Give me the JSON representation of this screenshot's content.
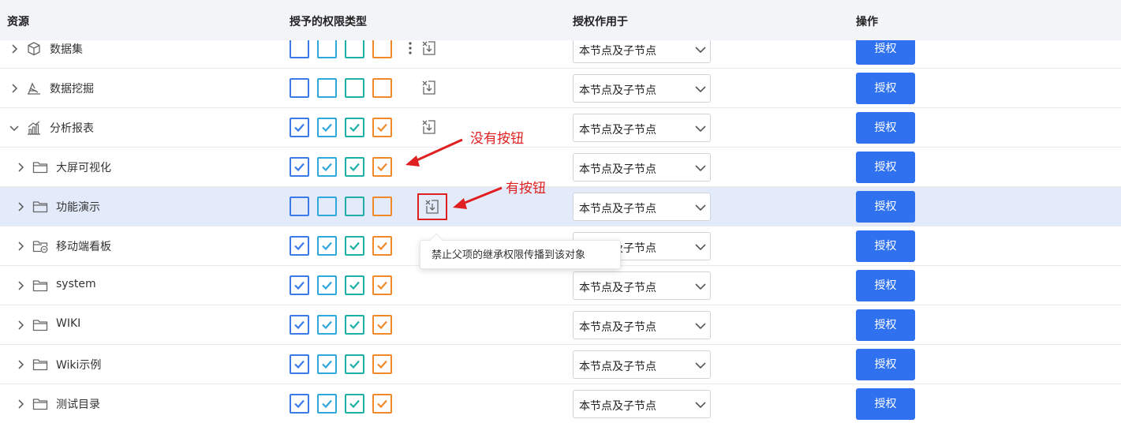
{
  "table": {
    "headers": {
      "resource": "资源",
      "permission_types": "授予的权限类型",
      "apply_to": "授权作用于",
      "action": "操作"
    },
    "rows": [
      {
        "name": "数据集",
        "icon": "cube-icon",
        "expand": "collapsed",
        "checked": false,
        "stop_inherit": true,
        "show_more": true,
        "apply_to": "本节点及子节点",
        "action": "授权"
      },
      {
        "name": "数据挖掘",
        "icon": "data-mining-icon",
        "expand": "collapsed",
        "checked": false,
        "stop_inherit": true,
        "apply_to": "本节点及子节点",
        "action": "授权"
      },
      {
        "name": "分析报表",
        "icon": "bar-chart-icon",
        "expand": "expanded",
        "checked": true,
        "stop_inherit": true,
        "apply_to": "本节点及子节点",
        "action": "授权"
      },
      {
        "name": "大屏可视化",
        "icon": "folder-icon",
        "expand": "collapsed",
        "checked": true,
        "stop_inherit": false,
        "apply_to": "本节点及子节点",
        "action": "授权"
      },
      {
        "name": "功能演示",
        "icon": "folder-icon",
        "expand": "collapsed",
        "checked": false,
        "stop_inherit": true,
        "highlighted": true,
        "apply_to": "本节点及子节点",
        "action": "授权"
      },
      {
        "name": "移动端看板",
        "icon": "mobile-folder-icon",
        "expand": "collapsed",
        "checked": true,
        "stop_inherit": false,
        "apply_to": "本节点及子节点",
        "action": "授权"
      },
      {
        "name": "system",
        "icon": "folder-icon",
        "expand": "collapsed",
        "checked": true,
        "stop_inherit": false,
        "apply_to": "本节点及子节点",
        "action": "授权"
      },
      {
        "name": "WIKI",
        "icon": "folder-icon",
        "expand": "collapsed",
        "checked": true,
        "stop_inherit": false,
        "apply_to": "本节点及子节点",
        "action": "授权"
      },
      {
        "name": "Wiki示例",
        "icon": "folder-icon",
        "expand": "collapsed",
        "checked": true,
        "stop_inherit": false,
        "apply_to": "本节点及子节点",
        "action": "授权"
      },
      {
        "name": "测试目录",
        "icon": "folder-icon",
        "expand": "collapsed",
        "checked": true,
        "stop_inherit": false,
        "apply_to": "本节点及子节点",
        "action": "授权"
      }
    ]
  },
  "tooltip": {
    "text": "禁止父项的继承权限传播到该对象"
  },
  "annotations": {
    "no_button": "没有按钮",
    "has_button": "有按钮"
  },
  "colors": {
    "header_bg": "#f2f4f8",
    "highlight_row": "#e3ebfa",
    "button_primary": "#2f71ef",
    "annotation_red": "#e02020",
    "checkbox_colors": [
      "#3a7be8",
      "#2fa8dc",
      "#1eb0a7",
      "#f0892a"
    ]
  }
}
